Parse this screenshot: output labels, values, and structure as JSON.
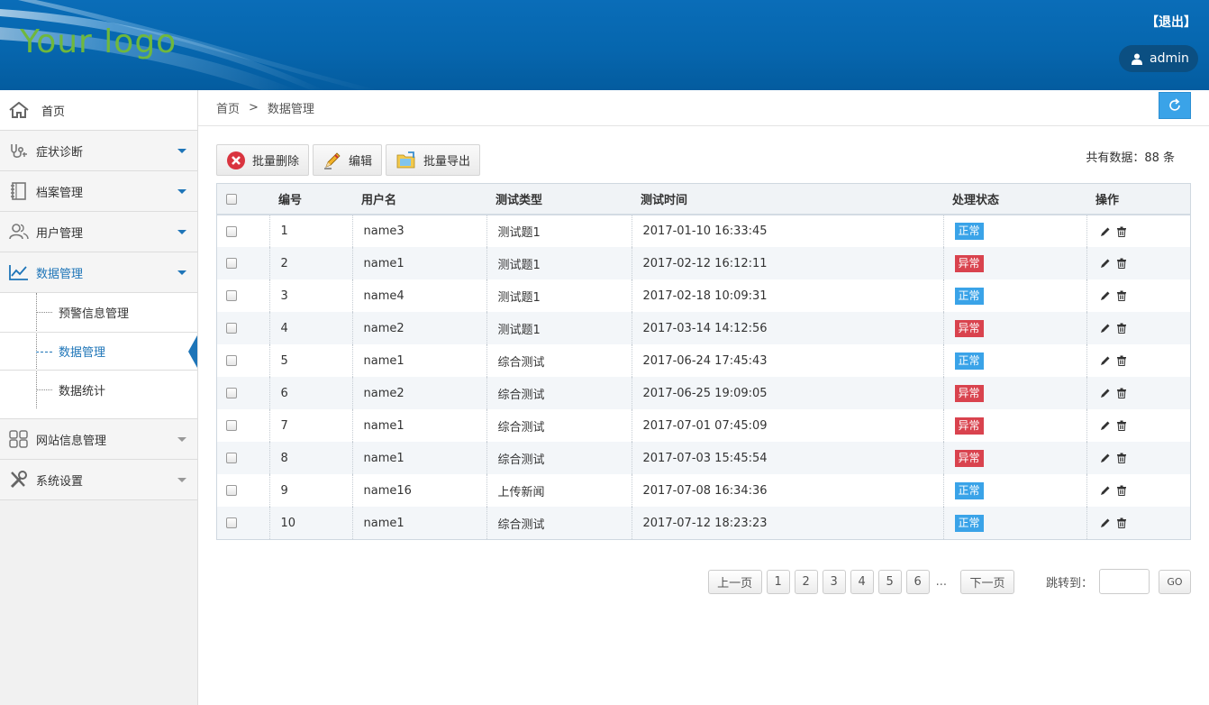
{
  "header": {
    "logo": "Your logo",
    "logout": "【退出】",
    "user": "admin"
  },
  "sidebar": {
    "home": "首页",
    "items": [
      {
        "label": "症状诊断"
      },
      {
        "label": "档案管理"
      },
      {
        "label": "用户管理"
      },
      {
        "label": "数据管理"
      },
      {
        "label": "网站信息管理"
      },
      {
        "label": "系统设置"
      }
    ],
    "submenu": [
      "预警信息管理",
      "数据管理",
      "数据统计"
    ]
  },
  "breadcrumb": {
    "home": "首页",
    "sep": ">",
    "current": "数据管理"
  },
  "toolbar": {
    "batch_delete": "批量删除",
    "edit": "编辑",
    "batch_export": "批量导出",
    "total": "共有数据：88 条"
  },
  "table": {
    "headers": [
      "编号",
      "用户名",
      "测试类型",
      "测试时间",
      "处理状态",
      "操作"
    ],
    "rows": [
      {
        "id": "1",
        "user": "name3",
        "type": "测试题1",
        "time": "2017-01-10 16:33:45",
        "status": "正常"
      },
      {
        "id": "2",
        "user": "name1",
        "type": "测试题1",
        "time": "2017-02-12 16:12:11",
        "status": "异常"
      },
      {
        "id": "3",
        "user": "name4",
        "type": "测试题1",
        "time": "2017-02-18 10:09:31",
        "status": "正常"
      },
      {
        "id": "4",
        "user": "name2",
        "type": "测试题1",
        "time": "2017-03-14 14:12:56",
        "status": "异常"
      },
      {
        "id": "5",
        "user": "name1",
        "type": "综合测试",
        "time": "2017-06-24 17:45:43",
        "status": "正常"
      },
      {
        "id": "6",
        "user": "name2",
        "type": "综合测试",
        "time": "2017-06-25 19:09:05",
        "status": "异常"
      },
      {
        "id": "7",
        "user": "name1",
        "type": "综合测试",
        "time": "2017-07-01 07:45:09",
        "status": "异常"
      },
      {
        "id": "8",
        "user": "name1",
        "type": "综合测试",
        "time": "2017-07-03 15:45:54",
        "status": "异常"
      },
      {
        "id": "9",
        "user": "name16",
        "type": "上传新闻",
        "time": "2017-07-08 16:34:36",
        "status": "正常"
      },
      {
        "id": "10",
        "user": "name1",
        "type": "综合测试",
        "time": "2017-07-12 18:23:23",
        "status": "正常"
      }
    ]
  },
  "pager": {
    "prev": "上一页",
    "pages": [
      "1",
      "2",
      "3",
      "4",
      "5",
      "6"
    ],
    "ellipsis": "...",
    "next": "下一页",
    "jump_label": "跳转到：",
    "go": "GO"
  },
  "colors": {
    "header_blue": "#0666ae",
    "accent": "#1e75b8",
    "ok": "#3aa3e8",
    "err": "#d9434e",
    "logo_green": "#6fb83d"
  }
}
